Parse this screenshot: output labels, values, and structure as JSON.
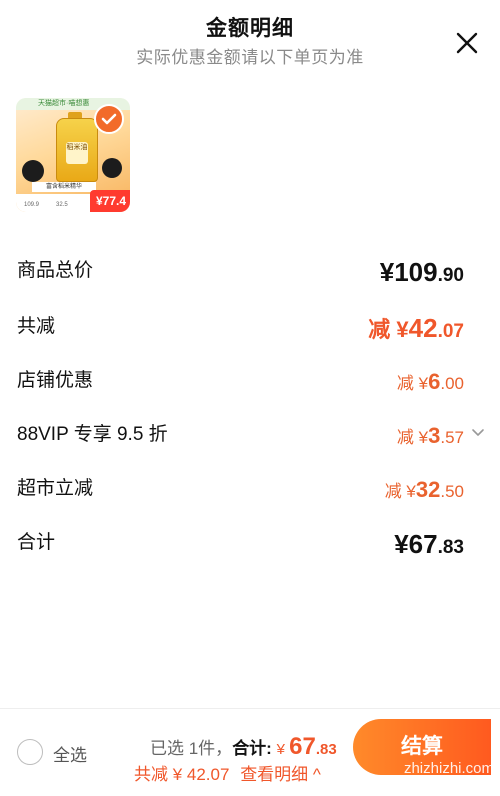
{
  "header": {
    "title": "金额明细",
    "subtitle": "实际优惠金额请以下单页为准"
  },
  "product": {
    "thumb_top_text": "天猫超市·喵想惠",
    "thumb_badge_text": "稻米油",
    "thumb_caption": "富含稻米精华",
    "thumb_price_old": "109.9",
    "thumb_price_mid": "32.5",
    "thumb_price_tag": "77.4"
  },
  "rows": {
    "total": {
      "label": "商品总价",
      "currency": "¥",
      "int": "109",
      "dec": ".90"
    },
    "discount": {
      "label": "共减",
      "prefix": "减 ¥",
      "int": "42",
      "dec": ".07"
    },
    "shop_coupon": {
      "label": "店铺优惠",
      "prefix": "减 ¥",
      "int": "6",
      "dec": ".00"
    },
    "vip": {
      "label": "88VIP 专享 9.5 折",
      "prefix": "减 ¥",
      "int": "3",
      "dec": ".57"
    },
    "market": {
      "label": "超市立减",
      "prefix": "减 ¥",
      "int": "32",
      "dec": ".50"
    },
    "sum": {
      "label": "合计",
      "currency": "¥",
      "int": "67",
      "dec": ".83"
    }
  },
  "footer": {
    "select_all": "全选",
    "selected_text": "已选 1件，",
    "total_label": "合计:",
    "total_currency": "¥ ",
    "total_int": "67",
    "total_dec": ".83",
    "discount_text": "共减 ¥ 42.07",
    "detail_link": "查看明细 ^",
    "checkout_label": "结算",
    "watermark": "zhizhizhi.com"
  },
  "colors": {
    "accent": "#f0572b",
    "checkout_start": "#ff8a2a",
    "checkout_end": "#ff5a1f"
  },
  "icons": {
    "close": "close-icon",
    "check": "check-icon",
    "chevron": "chevron-down-icon"
  }
}
